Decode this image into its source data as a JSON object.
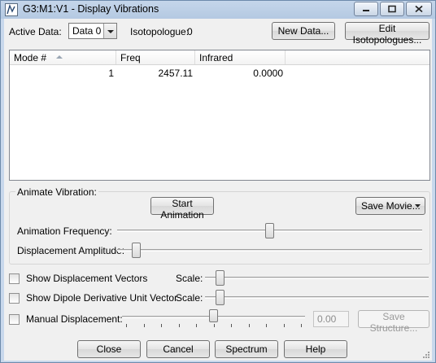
{
  "window": {
    "title": "G3:M1:V1 - Display Vibrations",
    "controls": [
      "minimize",
      "maximize",
      "close"
    ]
  },
  "header": {
    "active_data_label": "Active Data:",
    "active_data_value": "Data 0",
    "isotopologue_label": "Isotopologue:",
    "isotopologue_value": "0",
    "new_data_button": "New Data...",
    "edit_isotopologues_button": "Edit Isotopologues..."
  },
  "table": {
    "columns": [
      "Mode #",
      "Freq",
      "Infrared"
    ],
    "sort_column": "Mode #",
    "rows": [
      {
        "mode": "1",
        "freq": "2457.11",
        "infrared": "0.0000"
      }
    ]
  },
  "animate": {
    "group_label": "Animate Vibration:",
    "start_button": "Start Animation",
    "save_movie_button": "Save Movie...",
    "frequency_label": "Animation Frequency:",
    "frequency_position": 0.5,
    "amplitude_label": "Displacement Amplitude:",
    "amplitude_position": 0.05
  },
  "options": {
    "show_vectors_label": "Show Displacement Vectors",
    "show_vectors_checked": false,
    "vectors_scale_label": "Scale:",
    "vectors_scale_position": 0.05,
    "show_dipole_label": "Show Dipole Derivative Unit Vector",
    "show_dipole_checked": false,
    "dipole_scale_label": "Scale:",
    "dipole_scale_position": 0.05,
    "manual_label": "Manual Displacement:",
    "manual_checked": false,
    "manual_position": 0.5,
    "manual_value": "0.00",
    "save_structure_button": "Save Structure..."
  },
  "footer": {
    "close_button": "Close",
    "cancel_button": "Cancel",
    "spectrum_button": "Spectrum",
    "help_button": "Help"
  }
}
